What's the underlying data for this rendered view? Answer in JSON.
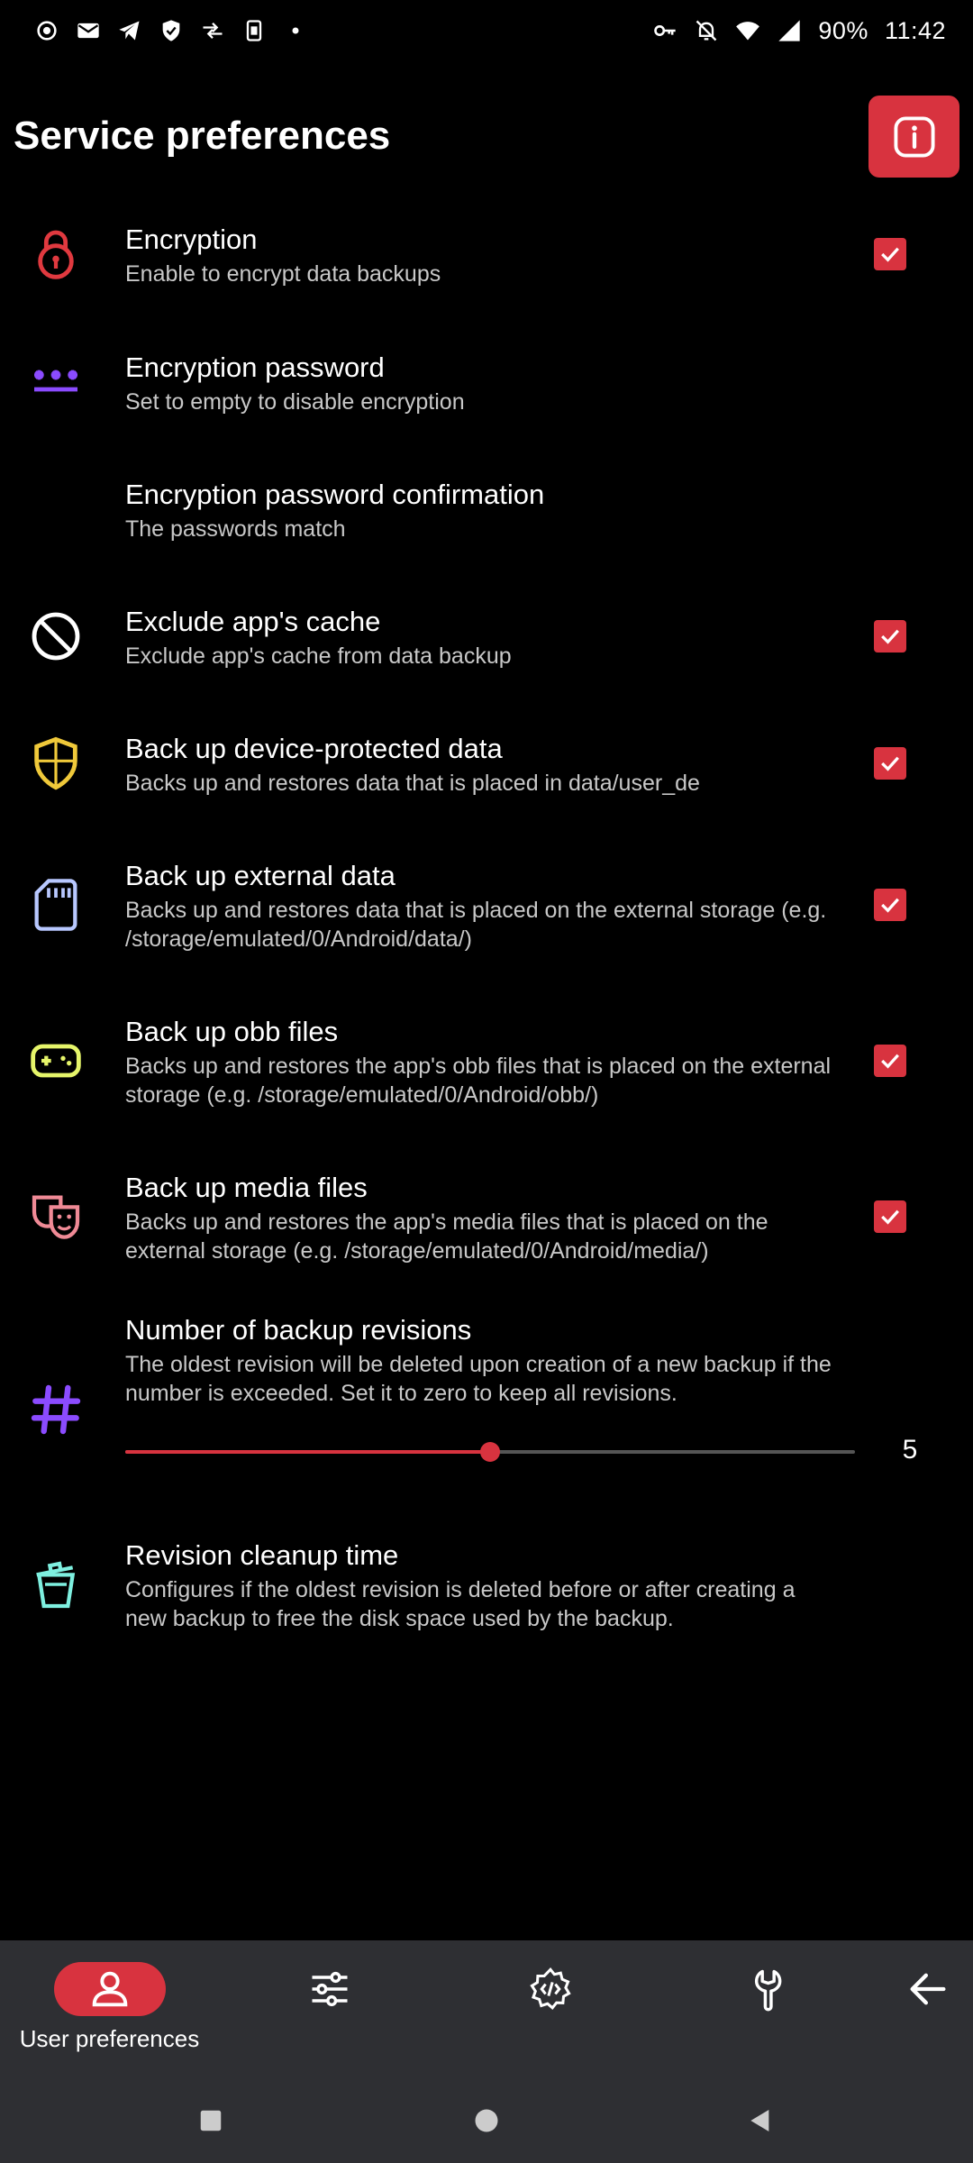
{
  "status_bar": {
    "battery": "90%",
    "time": "11:42"
  },
  "header": {
    "title": "Service preferences",
    "info_icon": "info-icon"
  },
  "preferences": [
    {
      "title": "Encryption",
      "summary": "Enable to encrypt data backups",
      "icon": "lock-icon",
      "checked": true
    },
    {
      "title": "Encryption password",
      "summary": "Set to empty to disable encryption",
      "icon": "password-icon"
    },
    {
      "title": "Encryption password confirmation",
      "summary": "The passwords match"
    },
    {
      "title": "Exclude app's cache",
      "summary": "Exclude app's cache from data backup",
      "icon": "block-icon",
      "checked": true
    },
    {
      "title": "Back up device-protected data",
      "summary": "Backs up and restores data that is placed in data/user_de",
      "icon": "shield-icon",
      "checked": true
    },
    {
      "title": "Back up external data",
      "summary": "Backs up and restores data that is placed on the external storage (e.g. /storage/emulated/0/Android/data/)",
      "icon": "sd-card-icon",
      "checked": true
    },
    {
      "title": "Back up obb files",
      "summary": "Backs up and restores the app's obb files that is placed on the external storage (e.g. /storage/emulated/0/Android/obb/)",
      "icon": "gamepad-icon",
      "checked": true
    },
    {
      "title": "Back up media files",
      "summary": "Backs up and restores the app's media files that is placed on the external storage (e.g. /storage/emulated/0/Android/media/)",
      "icon": "masks-icon",
      "checked": true
    },
    {
      "title": "Number of backup revisions",
      "summary": "The oldest revision will be deleted upon creation of a new backup if the number is exceeded. Set it to zero to keep all revisions.",
      "icon": "hash-icon"
    },
    {
      "title": "Revision cleanup time",
      "summary": "Configures if the oldest revision is deleted before or after creating a new backup to free the disk space used by the backup.",
      "icon": "trash-icon"
    }
  ],
  "revisions_slider": {
    "value": "5",
    "fraction": 0.5
  },
  "colors": {
    "accent": "#d8333f",
    "lock": "#e0393f",
    "password": "#8b4bff",
    "shield": "#f0c93a",
    "sd_card": "#b8c8ff",
    "gamepad": "#e6f56a",
    "masks": "#f08a96",
    "hash": "#8b4bff",
    "trash": "#7ef0e0"
  },
  "bottom_nav": {
    "active_label": "User preferences",
    "items": [
      "user-icon",
      "sliders-icon",
      "gear-code-icon",
      "wrench-icon",
      "back-arrow-icon"
    ]
  }
}
